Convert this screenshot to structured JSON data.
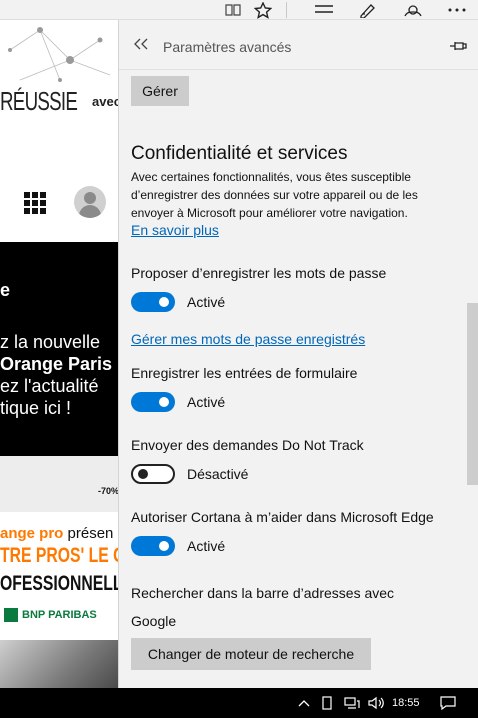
{
  "browser": {
    "toolbar_icons": [
      "reading-view-icon",
      "favorite-star-icon",
      "hub-icon",
      "web-note-icon",
      "share-icon",
      "more-icon"
    ]
  },
  "site": {
    "hero_text": "RÉUSSIE",
    "hero_avec": "avec",
    "banner_letter": "e",
    "banner_lines": [
      "z la nouvelle",
      "Orange Paris",
      "ez l'actualité",
      "tique ici !"
    ],
    "discount": "-70%",
    "promo_brand": "ange pro",
    "promo_suffix": "présen",
    "promo_line1": "TRE PROS' LE GU",
    "promo_line2": "OFESSIONNELLE P",
    "bnp": "BNP PARIBAS"
  },
  "panel": {
    "title": "Paramètres avancés",
    "manage_button": "Gérer",
    "section_title": "Confidentialité et services",
    "description": "Avec certaines fonctionnalités, vous êtes susceptible d’enregistrer des données sur votre appareil ou de les envoyer à Microsoft pour améliorer votre navigation.",
    "learn_more": "En savoir plus",
    "settings": [
      {
        "label": "Proposer d’enregistrer les mots de passe",
        "on": true,
        "state": "Activé"
      },
      {
        "label": "Enregistrer les entrées de formulaire",
        "on": true,
        "state": "Activé"
      },
      {
        "label": "Envoyer des demandes Do Not Track",
        "on": false,
        "state": "Désactivé"
      },
      {
        "label": "Autoriser Cortana à m’aider dans Microsoft Edge",
        "on": true,
        "state": "Activé"
      }
    ],
    "manage_passwords_link": "Gérer mes mots de passe enregistrés",
    "search_label": "Rechercher dans la barre d’adresses avec",
    "search_engine": "Google",
    "change_engine_button": "Changer de moteur de recherche",
    "accent_color": "#0078d7"
  },
  "taskbar": {
    "time": "18:55"
  }
}
